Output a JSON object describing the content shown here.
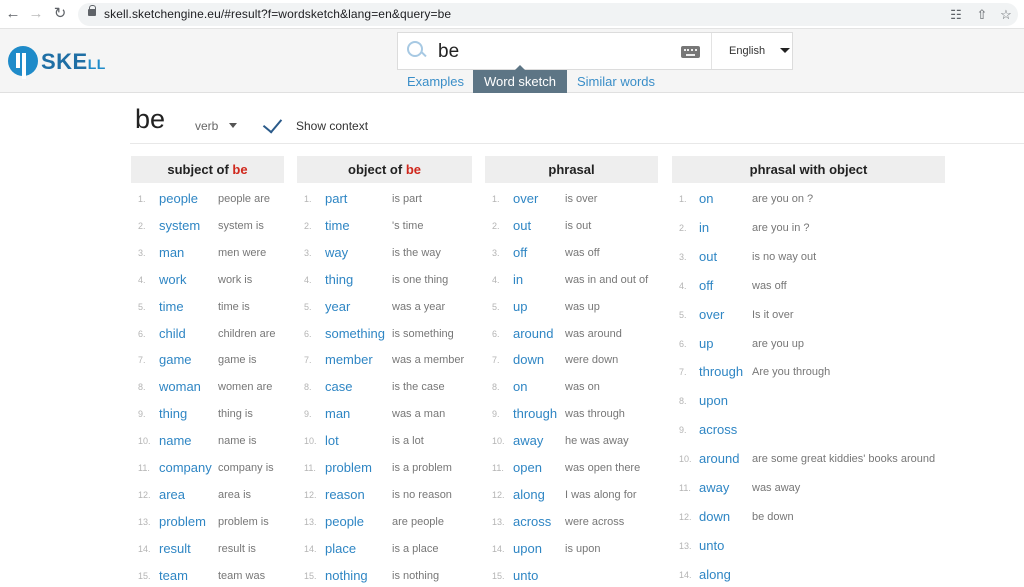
{
  "browser": {
    "url": "skell.sketchengine.eu/#result?f=wordsketch&lang=en&query=be"
  },
  "header": {
    "logo_main": "SKE",
    "logo_small": "LL",
    "search_value": "be",
    "language": "English",
    "tabs": [
      "Examples",
      "Word sketch",
      "Similar words"
    ]
  },
  "word": {
    "headword": "be",
    "pos": "verb",
    "show_context": "Show context"
  },
  "columns": [
    {
      "title": "subject of",
      "rel_word": "be",
      "rows": [
        {
          "n": "1.",
          "word": "people",
          "ex": "people are"
        },
        {
          "n": "2.",
          "word": "system",
          "ex": "system is"
        },
        {
          "n": "3.",
          "word": "man",
          "ex": "men were"
        },
        {
          "n": "4.",
          "word": "work",
          "ex": "work is"
        },
        {
          "n": "5.",
          "word": "time",
          "ex": "time is"
        },
        {
          "n": "6.",
          "word": "child",
          "ex": "children are"
        },
        {
          "n": "7.",
          "word": "game",
          "ex": "game is"
        },
        {
          "n": "8.",
          "word": "woman",
          "ex": "women are"
        },
        {
          "n": "9.",
          "word": "thing",
          "ex": "thing is"
        },
        {
          "n": "10.",
          "word": "name",
          "ex": "name is"
        },
        {
          "n": "11.",
          "word": "company",
          "ex": "company is"
        },
        {
          "n": "12.",
          "word": "area",
          "ex": "area is"
        },
        {
          "n": "13.",
          "word": "problem",
          "ex": "problem is"
        },
        {
          "n": "14.",
          "word": "result",
          "ex": "result is"
        },
        {
          "n": "15.",
          "word": "team",
          "ex": "team was"
        }
      ]
    },
    {
      "title": "object of",
      "rel_word": "be",
      "rows": [
        {
          "n": "1.",
          "word": "part",
          "ex": "is part"
        },
        {
          "n": "2.",
          "word": "time",
          "ex": "'s time"
        },
        {
          "n": "3.",
          "word": "way",
          "ex": "is the way"
        },
        {
          "n": "4.",
          "word": "thing",
          "ex": "is one thing"
        },
        {
          "n": "5.",
          "word": "year",
          "ex": "was a year"
        },
        {
          "n": "6.",
          "word": "something",
          "ex": "is something"
        },
        {
          "n": "7.",
          "word": "member",
          "ex": "was a member"
        },
        {
          "n": "8.",
          "word": "case",
          "ex": "is the case"
        },
        {
          "n": "9.",
          "word": "man",
          "ex": "was a man"
        },
        {
          "n": "10.",
          "word": "lot",
          "ex": "is a lot"
        },
        {
          "n": "11.",
          "word": "problem",
          "ex": "is a problem"
        },
        {
          "n": "12.",
          "word": "reason",
          "ex": "is no reason"
        },
        {
          "n": "13.",
          "word": "people",
          "ex": "are people"
        },
        {
          "n": "14.",
          "word": "place",
          "ex": "is a place"
        },
        {
          "n": "15.",
          "word": "nothing",
          "ex": "is nothing"
        }
      ]
    },
    {
      "title": "phrasal",
      "rel_word": "",
      "rows": [
        {
          "n": "1.",
          "word": "over",
          "ex": "is over"
        },
        {
          "n": "2.",
          "word": "out",
          "ex": "is out"
        },
        {
          "n": "3.",
          "word": "off",
          "ex": "was off"
        },
        {
          "n": "4.",
          "word": "in",
          "ex": "was in and out of"
        },
        {
          "n": "5.",
          "word": "up",
          "ex": "was up"
        },
        {
          "n": "6.",
          "word": "around",
          "ex": "was around"
        },
        {
          "n": "7.",
          "word": "down",
          "ex": "were down"
        },
        {
          "n": "8.",
          "word": "on",
          "ex": "was on"
        },
        {
          "n": "9.",
          "word": "through",
          "ex": "was through"
        },
        {
          "n": "10.",
          "word": "away",
          "ex": "he was away"
        },
        {
          "n": "11.",
          "word": "open",
          "ex": "was open there"
        },
        {
          "n": "12.",
          "word": "along",
          "ex": "I was along for"
        },
        {
          "n": "13.",
          "word": "across",
          "ex": "were across"
        },
        {
          "n": "14.",
          "word": "upon",
          "ex": "is upon"
        },
        {
          "n": "15.",
          "word": "unto",
          "ex": ""
        }
      ]
    },
    {
      "title": "phrasal with object",
      "rel_word": "",
      "rows": [
        {
          "n": "1.",
          "word": "on",
          "ex": "are you on ?"
        },
        {
          "n": "2.",
          "word": "in",
          "ex": "are you in ?"
        },
        {
          "n": "3.",
          "word": "out",
          "ex": "is no way out"
        },
        {
          "n": "4.",
          "word": "off",
          "ex": "was off"
        },
        {
          "n": "5.",
          "word": "over",
          "ex": "Is it over"
        },
        {
          "n": "6.",
          "word": "up",
          "ex": "are you up"
        },
        {
          "n": "7.",
          "word": "through",
          "ex": "Are you through"
        },
        {
          "n": "8.",
          "word": "upon",
          "ex": ""
        },
        {
          "n": "9.",
          "word": "across",
          "ex": ""
        },
        {
          "n": "10.",
          "word": "around",
          "ex": "are some great kiddies' books around"
        },
        {
          "n": "11.",
          "word": "away",
          "ex": "was away"
        },
        {
          "n": "12.",
          "word": "down",
          "ex": "be down"
        },
        {
          "n": "13.",
          "word": "unto",
          "ex": ""
        },
        {
          "n": "14.",
          "word": "along",
          "ex": ""
        }
      ]
    }
  ]
}
